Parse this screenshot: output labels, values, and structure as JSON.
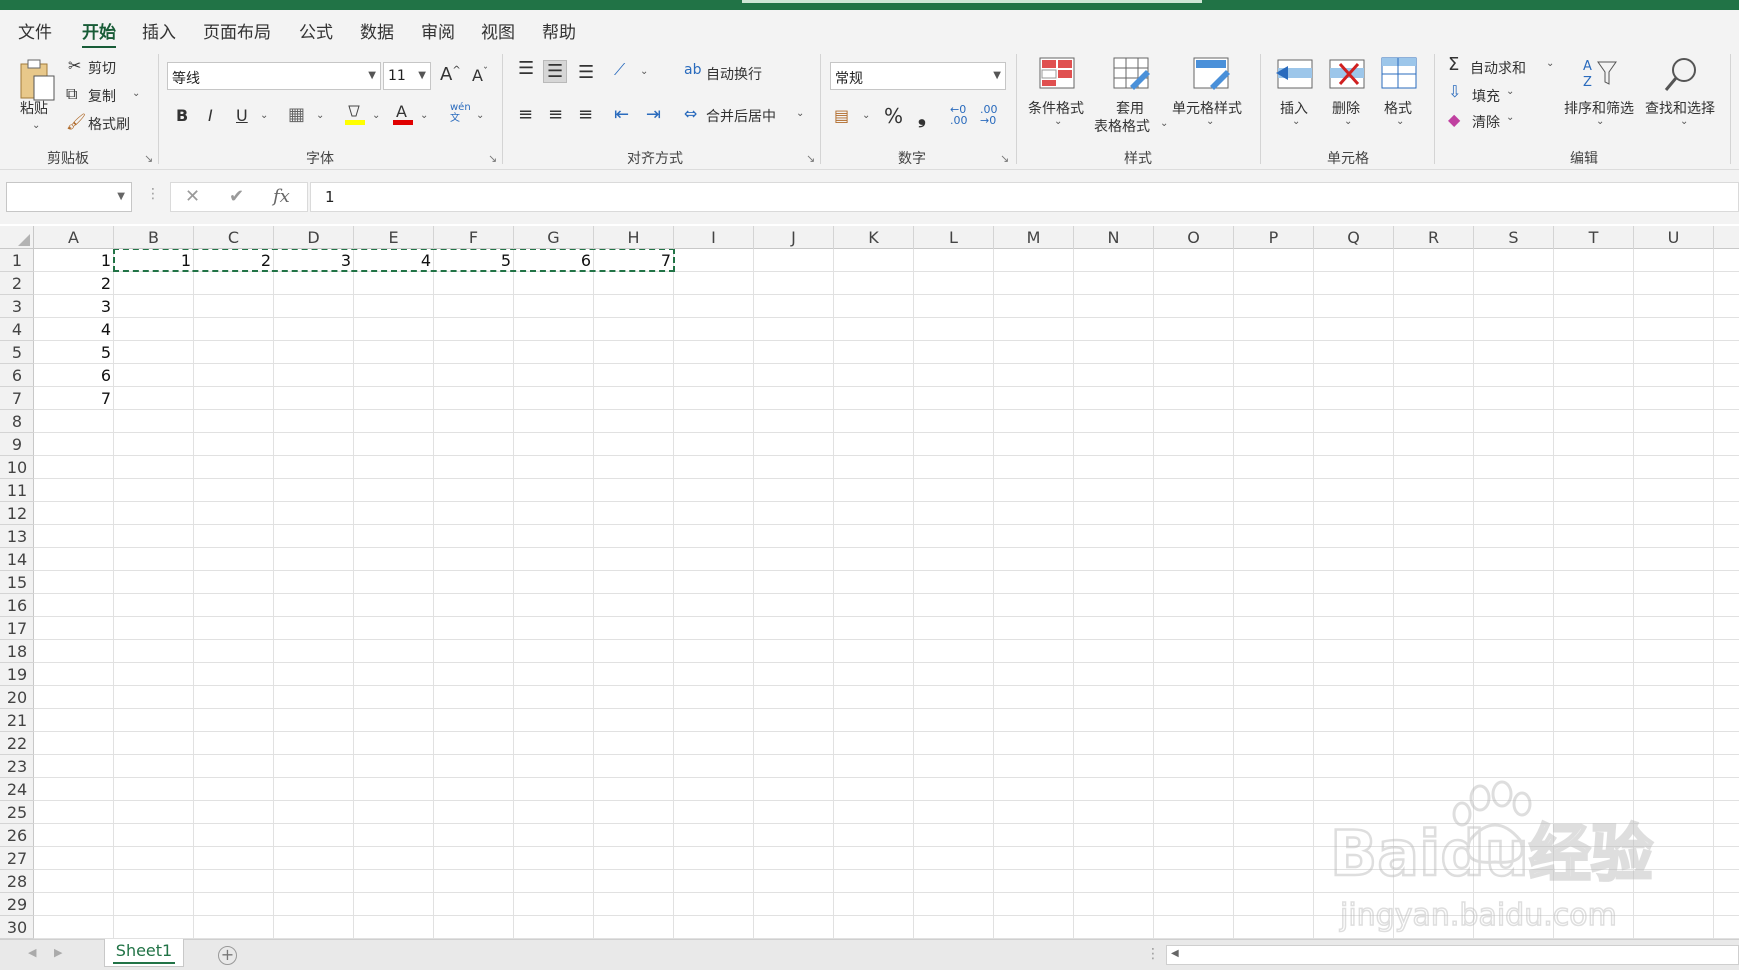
{
  "menu": {
    "tabs": [
      "文件",
      "开始",
      "插入",
      "页面布局",
      "公式",
      "数据",
      "审阅",
      "视图",
      "帮助"
    ],
    "active_tab": "开始"
  },
  "ribbon": {
    "clipboard": {
      "paste": "粘贴",
      "cut": "剪切",
      "copy": "复制",
      "format_painter": "格式刷",
      "label": "剪贴板"
    },
    "font": {
      "name": "等线",
      "size": "11",
      "bold": "B",
      "italic": "I",
      "underline": "U",
      "label": "字体"
    },
    "alignment": {
      "wrap": "自动换行",
      "merge": "合并后居中",
      "label": "对齐方式"
    },
    "number": {
      "format": "常规",
      "percent": "%",
      "comma": "❟",
      "label": "数字"
    },
    "styles": {
      "conditional": "条件格式",
      "table_line1": "套用",
      "table_line2": "表格格式",
      "cell_styles": "单元格样式",
      "label": "样式"
    },
    "cells": {
      "insert": "插入",
      "delete": "删除",
      "format": "格式",
      "label": "单元格"
    },
    "editing": {
      "autosum": "自动求和",
      "fill": "填充",
      "clear": "清除",
      "sort": "排序和筛选",
      "find": "查找和选择",
      "label": "编辑"
    }
  },
  "formula_bar": {
    "name_box": "",
    "cancel": "✕",
    "enter": "✔",
    "fx": "fx",
    "value": "1"
  },
  "grid": {
    "columns": [
      "A",
      "B",
      "C",
      "D",
      "E",
      "F",
      "G",
      "H",
      "I",
      "J",
      "K",
      "L",
      "M",
      "N",
      "O",
      "P",
      "Q",
      "R",
      "S",
      "T",
      "U"
    ],
    "rows": [
      "1",
      "2",
      "3",
      "4",
      "5",
      "6",
      "7",
      "8",
      "9",
      "10",
      "11",
      "12",
      "13",
      "14",
      "15",
      "16",
      "17",
      "18",
      "19",
      "20",
      "21",
      "22",
      "23",
      "24",
      "25",
      "26",
      "27",
      "28",
      "29",
      "30"
    ],
    "col_a_values": [
      "1",
      "2",
      "3",
      "4",
      "5",
      "6",
      "7"
    ],
    "row1_values": [
      "1",
      "2",
      "3",
      "4",
      "5",
      "6",
      "7"
    ]
  },
  "sheets": {
    "active": "Sheet1",
    "add": "+"
  },
  "watermark": {
    "brand": "Baidu经验",
    "url": "jingyan.baidu.com"
  },
  "colors": {
    "accent": "#217346",
    "tab_active": "#185c37",
    "marquee": "#217346"
  }
}
